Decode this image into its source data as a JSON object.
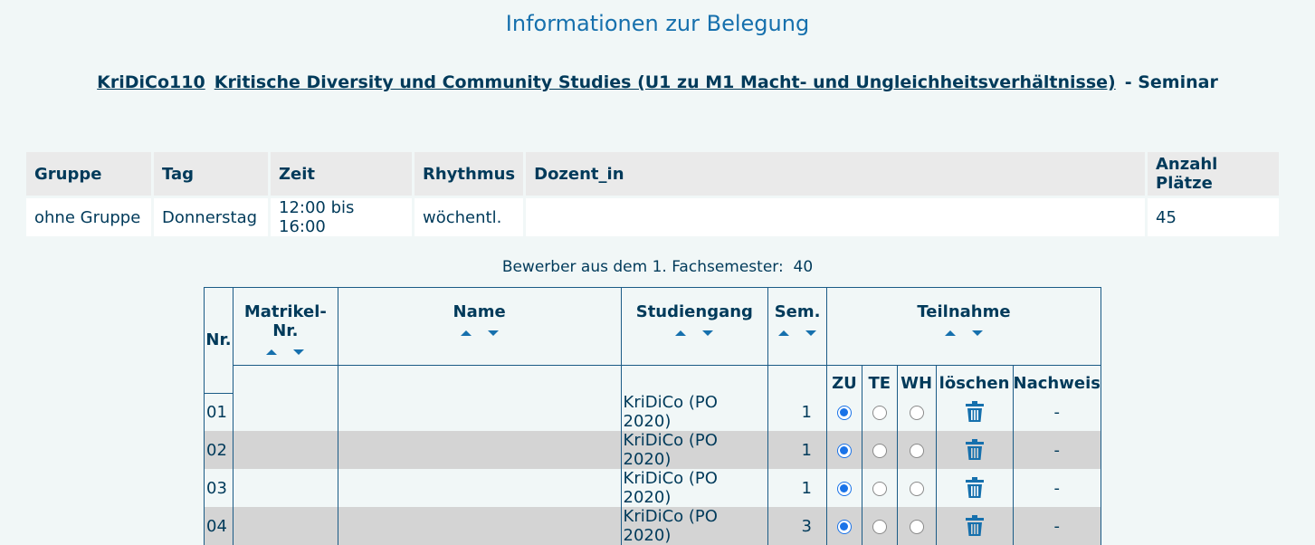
{
  "page_title": "Informationen zur Belegung",
  "course": {
    "code": "KriDiCo110",
    "title": "Kritische Diversity und Community Studies (U1 zu M1 Macht- und Ungleichheitsverhältnisse)",
    "type": "- Seminar"
  },
  "info_table": {
    "headers": [
      "Gruppe",
      "Tag",
      "Zeit",
      "Rhythmus",
      "Dozent_in",
      "Anzahl Plätze"
    ],
    "row": [
      "ohne Gruppe",
      "Donnerstag",
      "12:00 bis 16:00",
      "wöchentl.",
      "",
      "45"
    ]
  },
  "bewerber_label": "Bewerber aus dem 1. Fachsemester:",
  "bewerber_count": "40",
  "applicants": {
    "headers": {
      "nr": "Nr.",
      "matrikel": "Matrikel-Nr.",
      "name": "Name",
      "studiengang": "Studiengang",
      "sem": "Sem.",
      "teilnahme": "Teilnahme"
    },
    "sub_headers": [
      "ZU",
      "TE",
      "WH",
      "löschen",
      "Nachweis"
    ],
    "rows": [
      {
        "nr": "01",
        "studiengang": "KriDiCo (PO 2020)",
        "sem": "1",
        "status": "ZU",
        "nachweis": "-"
      },
      {
        "nr": "02",
        "studiengang": "KriDiCo (PO 2020)",
        "sem": "1",
        "status": "ZU",
        "nachweis": "-"
      },
      {
        "nr": "03",
        "studiengang": "KriDiCo (PO 2020)",
        "sem": "1",
        "status": "ZU",
        "nachweis": "-"
      },
      {
        "nr": "04",
        "studiengang": "KriDiCo (PO 2020)",
        "sem": "3",
        "status": "ZU",
        "nachweis": "-"
      }
    ]
  },
  "colors": {
    "background": "#f1f7f7",
    "title": "#1670ad",
    "text": "#003a5a",
    "row_alt": "#d4d4d4",
    "radio_selected": "#1a73e8"
  },
  "icons": [
    "sort-up-icon",
    "sort-down-icon",
    "trash-icon"
  ]
}
